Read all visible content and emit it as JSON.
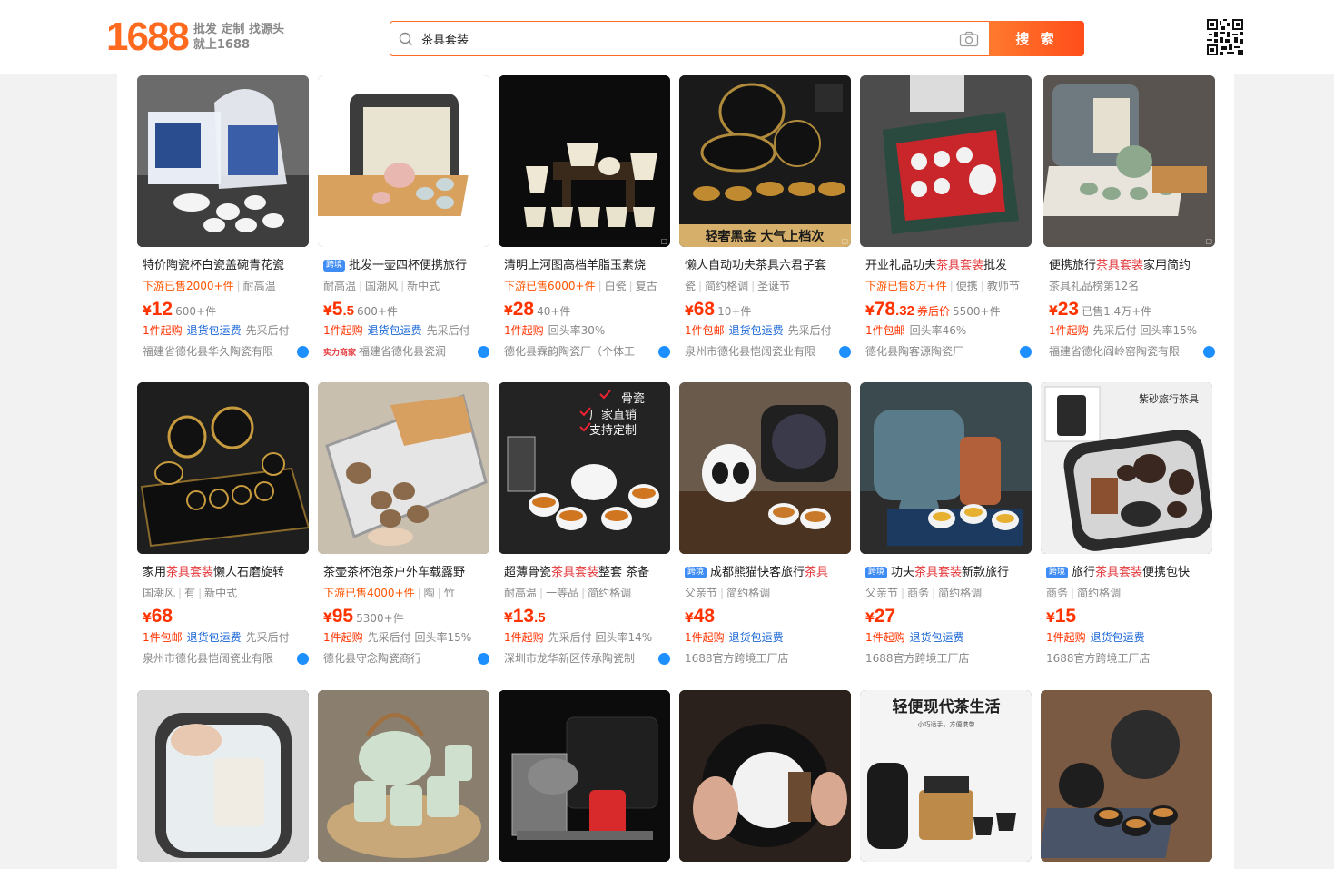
{
  "header": {
    "logo_number": "1688",
    "logo_slogan_1": "批发 定制 找源头",
    "logo_slogan_2": "就上1688",
    "search_value": "茶具套装",
    "search_button": "搜 索"
  },
  "products": [
    {
      "title_pre": "特价陶瓷杯白瓷盖碗青花瓷",
      "hl": "",
      "title_post": "",
      "badge": "",
      "tags": [
        {
          "t": "下游已售2000+件",
          "o": true
        },
        {
          "t": "耐高温"
        }
      ],
      "yen": "¥",
      "price": "12",
      "price_dec": "",
      "sold": "600+件",
      "svc_red": "1件起购",
      "svc_blue": "退货包运费",
      "svc_gray": "先采后付",
      "strength": "",
      "shop": "福建省德化县华久陶瓷有限",
      "vip": true
    },
    {
      "title_pre": "批发一壶四杯便携旅行",
      "hl": "",
      "title_post": "",
      "badge": "跨境",
      "tags": [
        {
          "t": "耐高温"
        },
        {
          "t": "国潮风"
        },
        {
          "t": "新中式"
        }
      ],
      "yen": "¥",
      "price": "5",
      "price_dec": ".5",
      "sold": "600+件",
      "svc_red": "1件起购",
      "svc_blue": "退货包运费",
      "svc_gray": "先采后付",
      "strength": "实力商家",
      "shop": "福建省德化县瓷润",
      "vip": true
    },
    {
      "title_pre": "清明上河图高档羊脂玉素烧",
      "hl": "",
      "title_post": "",
      "badge": "",
      "tags": [
        {
          "t": "下游已售6000+件",
          "o": true
        },
        {
          "t": "白瓷"
        },
        {
          "t": "复古"
        }
      ],
      "yen": "¥",
      "price": "28",
      "price_dec": "",
      "sold": "40+件",
      "svc_red": "1件起购",
      "svc_blue": "",
      "svc_gray": "回头率30%",
      "strength": "",
      "shop": "德化县霖韵陶瓷厂（个体工",
      "vip": true
    },
    {
      "title_pre": "懒人自动功夫茶具六君子套",
      "hl": "",
      "title_post": "",
      "badge": "",
      "tags": [
        {
          "t": "瓷"
        },
        {
          "t": "简约格调"
        },
        {
          "t": "圣诞节"
        }
      ],
      "yen": "¥",
      "price": "68",
      "price_dec": "",
      "sold": "10+件",
      "svc_red": "1件包邮",
      "svc_blue": "退货包运费",
      "svc_gray": "先采后付",
      "strength": "",
      "shop": "泉州市德化县恺阔瓷业有限",
      "vip": true
    },
    {
      "title_pre": "开业礼品功夫",
      "hl": "茶具套装",
      "title_post": "批发",
      "badge": "",
      "tags": [
        {
          "t": "下游已售8万+件",
          "o": true
        },
        {
          "t": "便携"
        },
        {
          "t": "教师节"
        }
      ],
      "yen": "¥",
      "price": "78",
      "price_dec": ".32",
      "coupon": "券后价",
      "sold": "5500+件",
      "svc_red": "1件包邮",
      "svc_blue": "",
      "svc_gray": "回头率46%",
      "strength": "",
      "shop": "德化县陶客源陶瓷厂",
      "vip": true
    },
    {
      "title_pre": "便携旅行",
      "hl": "茶具套装",
      "title_post": "家用简约",
      "badge": "",
      "tags": [
        {
          "t": "茶具礼品榜第12名"
        }
      ],
      "yen": "¥",
      "price": "23",
      "price_dec": "",
      "sold": "已售1.4万+件",
      "svc_red": "1件起购",
      "svc_blue": "",
      "svc_gray": "先采后付  回头率15%",
      "strength": "",
      "shop": "福建省德化阎岭窑陶瓷有限",
      "vip": true
    },
    {
      "title_pre": "家用",
      "hl": "茶具套装",
      "title_post": "懒人石磨旋转",
      "badge": "",
      "tags": [
        {
          "t": "国潮风"
        },
        {
          "t": "有"
        },
        {
          "t": "新中式"
        }
      ],
      "yen": "¥",
      "price": "68",
      "price_dec": "",
      "sold": "",
      "svc_red": "1件包邮",
      "svc_blue": "退货包运费",
      "svc_gray": "先采后付",
      "strength": "",
      "shop": "泉州市德化县恺阔瓷业有限",
      "vip": true
    },
    {
      "title_pre": "茶壶茶杯泡茶户外车载露野",
      "hl": "",
      "title_post": "",
      "badge": "",
      "tags": [
        {
          "t": "下游已售4000+件",
          "o": true
        },
        {
          "t": "陶"
        },
        {
          "t": "竹"
        }
      ],
      "yen": "¥",
      "price": "95",
      "price_dec": "",
      "sold": "5300+件",
      "svc_red": "1件起购",
      "svc_blue": "",
      "svc_gray": "先采后付  回头率15%",
      "strength": "",
      "shop": "德化县守念陶瓷商行",
      "vip": true
    },
    {
      "title_pre": "超薄骨瓷",
      "hl": "茶具套装",
      "title_post": "整套 茶备",
      "badge": "",
      "tags": [
        {
          "t": "耐高温"
        },
        {
          "t": "一等品"
        },
        {
          "t": "简约格调"
        }
      ],
      "yen": "¥",
      "price": "13",
      "price_dec": ".5",
      "sold": "",
      "svc_red": "1件起购",
      "svc_blue": "",
      "svc_gray": "先采后付  回头率14%",
      "strength": "",
      "shop": "深圳市龙华新区传承陶瓷制",
      "vip": true
    },
    {
      "title_pre": "成都熊猫快客旅行",
      "hl": "茶具",
      "title_post": "",
      "badge": "跨境",
      "tags": [
        {
          "t": "父亲节"
        },
        {
          "t": "简约格调"
        }
      ],
      "yen": "¥",
      "price": "48",
      "price_dec": "",
      "sold": "",
      "svc_red": "1件起购",
      "svc_blue": "退货包运费",
      "svc_gray": "",
      "strength": "",
      "shop": "1688官方跨境工厂店",
      "vip": false
    },
    {
      "title_pre": "功夫",
      "hl": "茶具套装",
      "title_post": "新款旅行",
      "badge": "跨境",
      "tags": [
        {
          "t": "父亲节"
        },
        {
          "t": "商务"
        },
        {
          "t": "简约格调"
        }
      ],
      "yen": "¥",
      "price": "27",
      "price_dec": "",
      "sold": "",
      "svc_red": "1件起购",
      "svc_blue": "退货包运费",
      "svc_gray": "",
      "strength": "",
      "shop": "1688官方跨境工厂店",
      "vip": false
    },
    {
      "title_pre": "旅行",
      "hl": "茶具套装",
      "title_post": "便携包快",
      "badge": "跨境",
      "tags": [
        {
          "t": "商务"
        },
        {
          "t": "简约格调"
        }
      ],
      "yen": "¥",
      "price": "15",
      "price_dec": "",
      "sold": "",
      "svc_red": "1件起购",
      "svc_blue": "退货包运费",
      "svc_gray": "",
      "strength": "",
      "shop": "1688官方跨境工厂店",
      "vip": false
    }
  ],
  "image_texts": {
    "p4_banner": "轻奢黑金 大气上档次",
    "p9_line1": "骨瓷",
    "p9_line2": "厂家直销",
    "p9_line3": "支持定制",
    "p12_title": "紫砂旅行茶具",
    "p17_title": "轻便现代茶生活",
    "p17_sub": "小巧适手，方便携带"
  },
  "colors": {
    "brand": "#ff6a1f",
    "price": "#ff3300",
    "highlight": "#e4393c",
    "link": "#1a66d6"
  }
}
